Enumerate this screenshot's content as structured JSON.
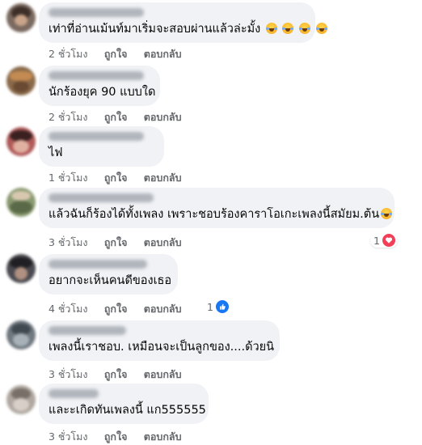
{
  "comments": [
    {
      "text": "เท่าที่อ่านเม้นท์มาเริ่มจะสอบผ่านแล้วล่ะมั้ง",
      "emoji_icons": [
        "rofl-emoji-icon",
        "rofl-emoji-icon",
        "rofl-emoji-icon",
        "rofl-emoji-icon"
      ],
      "time": "2 ชั่วโมง",
      "like_label": "ถูกใจ",
      "reply_label": "ตอบกลับ"
    },
    {
      "text": "นักร้องยุค 90 แบบใด",
      "time": "2 ชั่วโมง",
      "like_label": "ถูกใจ",
      "reply_label": "ตอบกลับ"
    },
    {
      "text": "ไฟ",
      "time": "1 ชั่วโมง",
      "like_label": "ถูกใจ",
      "reply_label": "ตอบกลับ"
    },
    {
      "text": "แล้วฉันก็ร้องได้ทั้งเพลง เพราะชอบร้องคาราโอเกะเพลงนี้สมัยม.ต้น",
      "emoji_icons": [
        "rofl-emoji-icon"
      ],
      "time": "3 ชั่วโมง",
      "like_label": "ถูกใจ",
      "reply_label": "ตอบกลับ",
      "reaction": {
        "count": "1",
        "type": "love-reaction-icon",
        "color": "#f33e58"
      }
    },
    {
      "text": "อยากจะเห็นคนดีของเธอ",
      "time": "4 ชั่วโมง",
      "like_label": "ถูกใจ",
      "reply_label": "ตอบกลับ",
      "reaction": {
        "count": "1",
        "type": "like-reaction-icon",
        "color": "#1877f2"
      }
    },
    {
      "text": "เพลงนี้เราชอบ. เหมือนจะเป็นลูกของ....ด้วยนิ",
      "time": "3 ชั่วโมง",
      "like_label": "ถูกใจ",
      "reply_label": "ตอบกลับ"
    },
    {
      "text": "และะเกิดทันเพลงนี้ แก555555",
      "time": "3 ชั่วโมง",
      "like_label": "ถูกใจ",
      "reply_label": "ตอบกลับ"
    }
  ],
  "colors": {
    "bubble": "#f0f2f5",
    "meta_text": "#65676b",
    "body_text": "#050505"
  }
}
